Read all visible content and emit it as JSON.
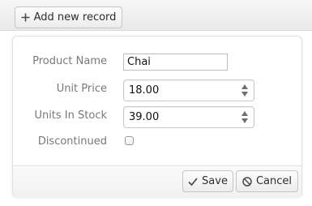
{
  "toolbar": {
    "add_icon": "plus-icon",
    "add_label": "Add new record"
  },
  "form": {
    "product_name_label": "Product Name",
    "product_name_value": "Chai",
    "unit_price_label": "Unit Price",
    "unit_price_value": "18.00",
    "units_in_stock_label": "Units In Stock",
    "units_in_stock_value": "39.00",
    "discontinued_label": "Discontinued",
    "discontinued_checked": false
  },
  "actions": {
    "save_icon": "check-icon",
    "save_label": "Save",
    "cancel_icon": "cancel-icon",
    "cancel_label": "Cancel"
  }
}
